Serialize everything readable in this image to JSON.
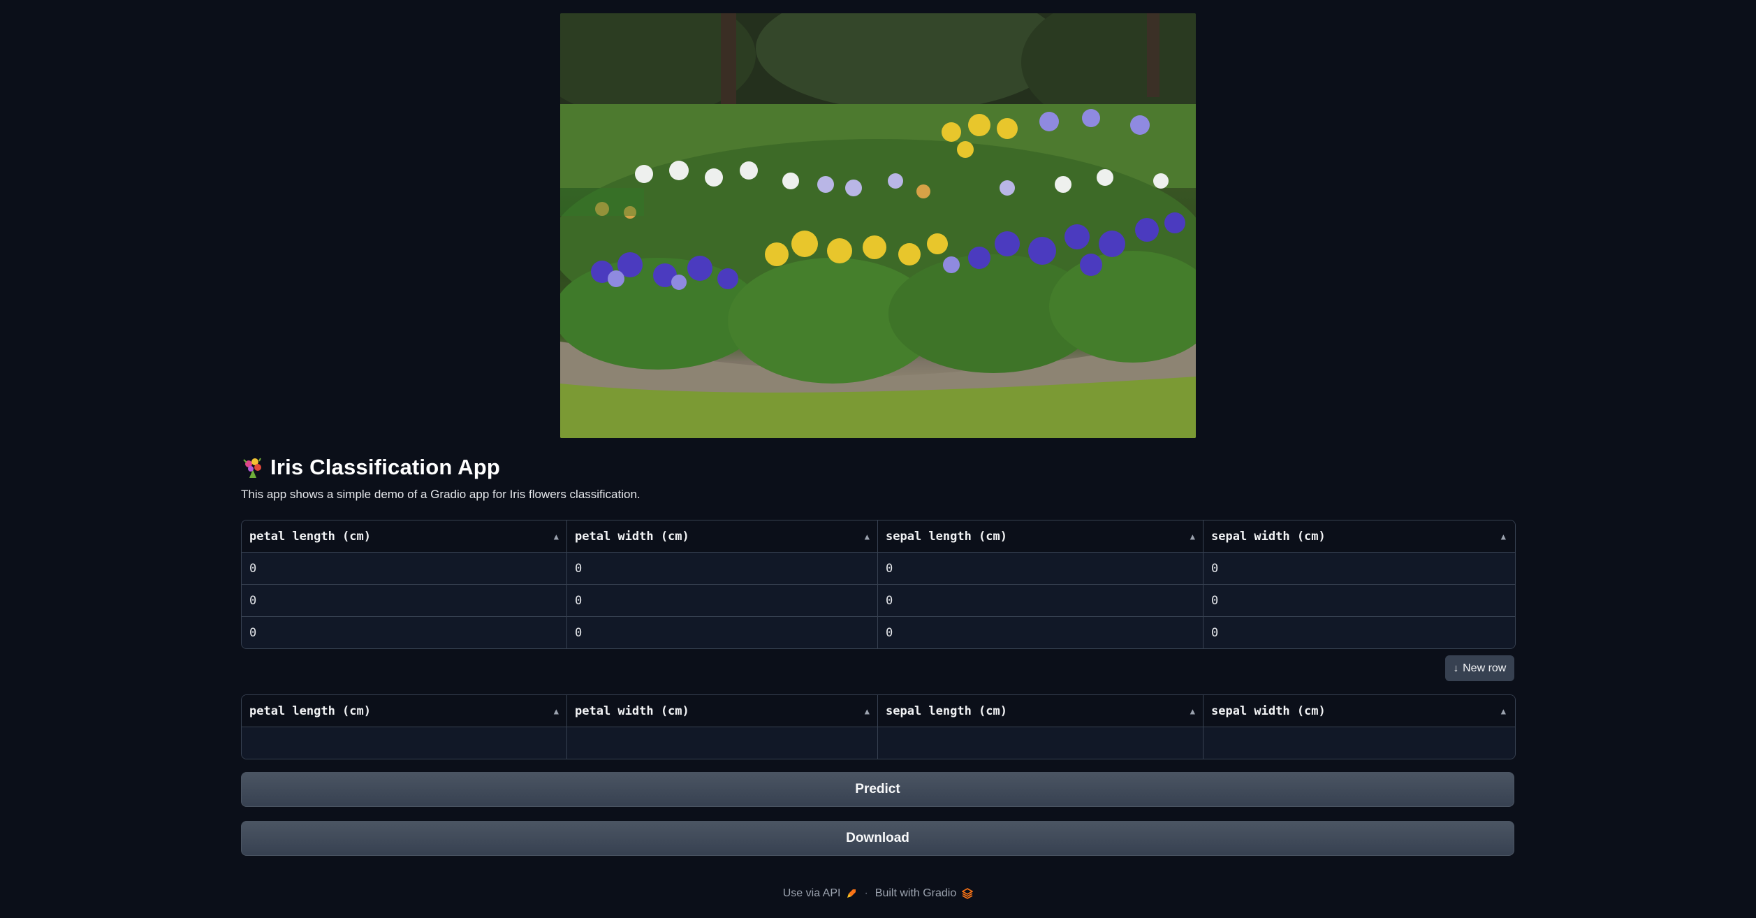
{
  "header": {
    "title": "Iris Classification App",
    "title_icon": "bouquet-icon",
    "description": "This app shows a simple demo of a Gradio app for Iris flowers classification."
  },
  "input_table": {
    "columns": [
      "petal length (cm)",
      "petal width (cm)",
      "sepal length (cm)",
      "sepal width (cm)"
    ],
    "rows": [
      [
        "0",
        "0",
        "0",
        "0"
      ],
      [
        "0",
        "0",
        "0",
        "0"
      ],
      [
        "0",
        "0",
        "0",
        "0"
      ]
    ]
  },
  "new_row_button": {
    "label": "New row",
    "icon": "arrow-down-icon"
  },
  "output_table": {
    "columns": [
      "petal length (cm)",
      "petal width (cm)",
      "sepal length (cm)",
      "sepal width (cm)"
    ],
    "rows": [
      [
        "",
        "",
        "",
        ""
      ]
    ]
  },
  "buttons": {
    "predict": "Predict",
    "download": "Download"
  },
  "footer": {
    "api_label": "Use via API",
    "api_icon": "rocket-icon",
    "separator": "·",
    "built_label": "Built with Gradio",
    "built_icon": "gradio-logo-icon"
  },
  "colors": {
    "background": "#0b0f19",
    "table_bg": "#111827",
    "border": "#374151",
    "button": "#4b5563"
  }
}
